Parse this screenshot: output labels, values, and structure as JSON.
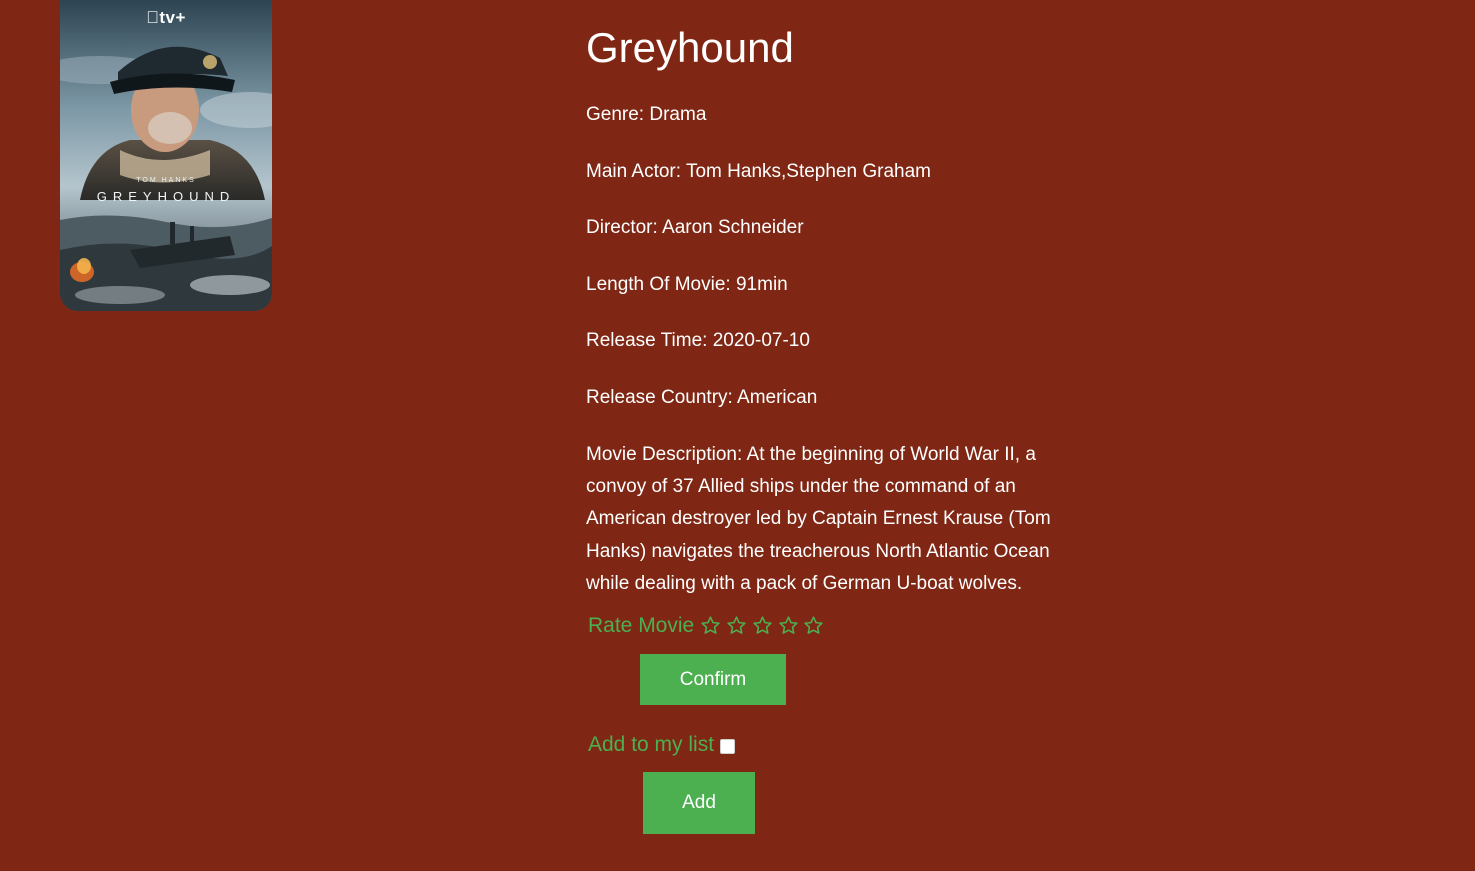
{
  "poster": {
    "brand": "tv+",
    "brand_text": "tv+",
    "actor_text": "TOM HANKS",
    "title_text": "GREYHOUND"
  },
  "movie": {
    "title": "Greyhound",
    "genre_label": "Genre:",
    "genre": "Drama",
    "actor_label": "Main Actor:",
    "actor": "Tom Hanks,Stephen Graham",
    "director_label": "Director:",
    "director": "Aaron Schneider",
    "length_label": "Length Of Movie:",
    "length": "91min",
    "release_label": "Release Time:",
    "release": "2020-07-10",
    "country_label": "Release Country:",
    "country": "American",
    "description_label": "Movie Description:",
    "description": "At the beginning of World War II, a convoy of 37 Allied ships under the command of an American destroyer led by Captain Ernest Krause (Tom Hanks) navigates the treacherous North Atlantic Ocean while dealing with a pack of German U-boat wolves."
  },
  "rating": {
    "label": "Rate Movie",
    "max_stars": 5,
    "selected": 0,
    "confirm_label": "Confirm"
  },
  "my_list": {
    "label": "Add to my list",
    "checked": false,
    "add_label": "Add"
  },
  "colors": {
    "background": "#7f2714",
    "accent": "#4caf50",
    "text": "#ffffff"
  }
}
